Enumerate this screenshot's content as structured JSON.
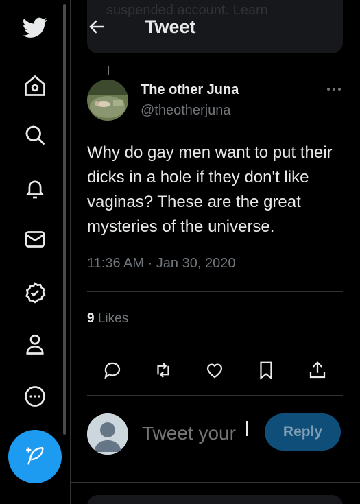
{
  "colors": {
    "accent": "#1d9bf0",
    "background": "#000000",
    "text": "#e7e9ea",
    "muted": "#71767b",
    "divider": "#2f3336"
  },
  "sidebar": {
    "items": [
      {
        "icon": "twitter-logo-icon"
      },
      {
        "icon": "home-icon"
      },
      {
        "icon": "search-icon"
      },
      {
        "icon": "notifications-bell-icon"
      },
      {
        "icon": "messages-envelope-icon"
      },
      {
        "icon": "verified-badge-icon"
      },
      {
        "icon": "profile-person-icon"
      },
      {
        "icon": "more-circle-icon"
      }
    ],
    "compose_icon": "compose-feather-icon"
  },
  "partial_card_text": "suspended account. Learn",
  "header": {
    "title": "Tweet",
    "back_icon": "back-arrow-icon"
  },
  "tweet": {
    "author_name": "The other Juna",
    "author_handle": "@theotherjuna",
    "text": "Why do gay men want to put their dicks in a hole if they don't like vaginas? These are the great mysteries of the universe.",
    "timestamp": "11:36 AM · Jan 30, 2020",
    "likes_count": "9",
    "likes_label": "Likes",
    "actions": [
      "reply-icon",
      "retweet-icon",
      "like-heart-icon",
      "bookmark-icon",
      "share-icon"
    ]
  },
  "reply": {
    "placeholder": "Tweet your",
    "button_label": "Reply"
  }
}
